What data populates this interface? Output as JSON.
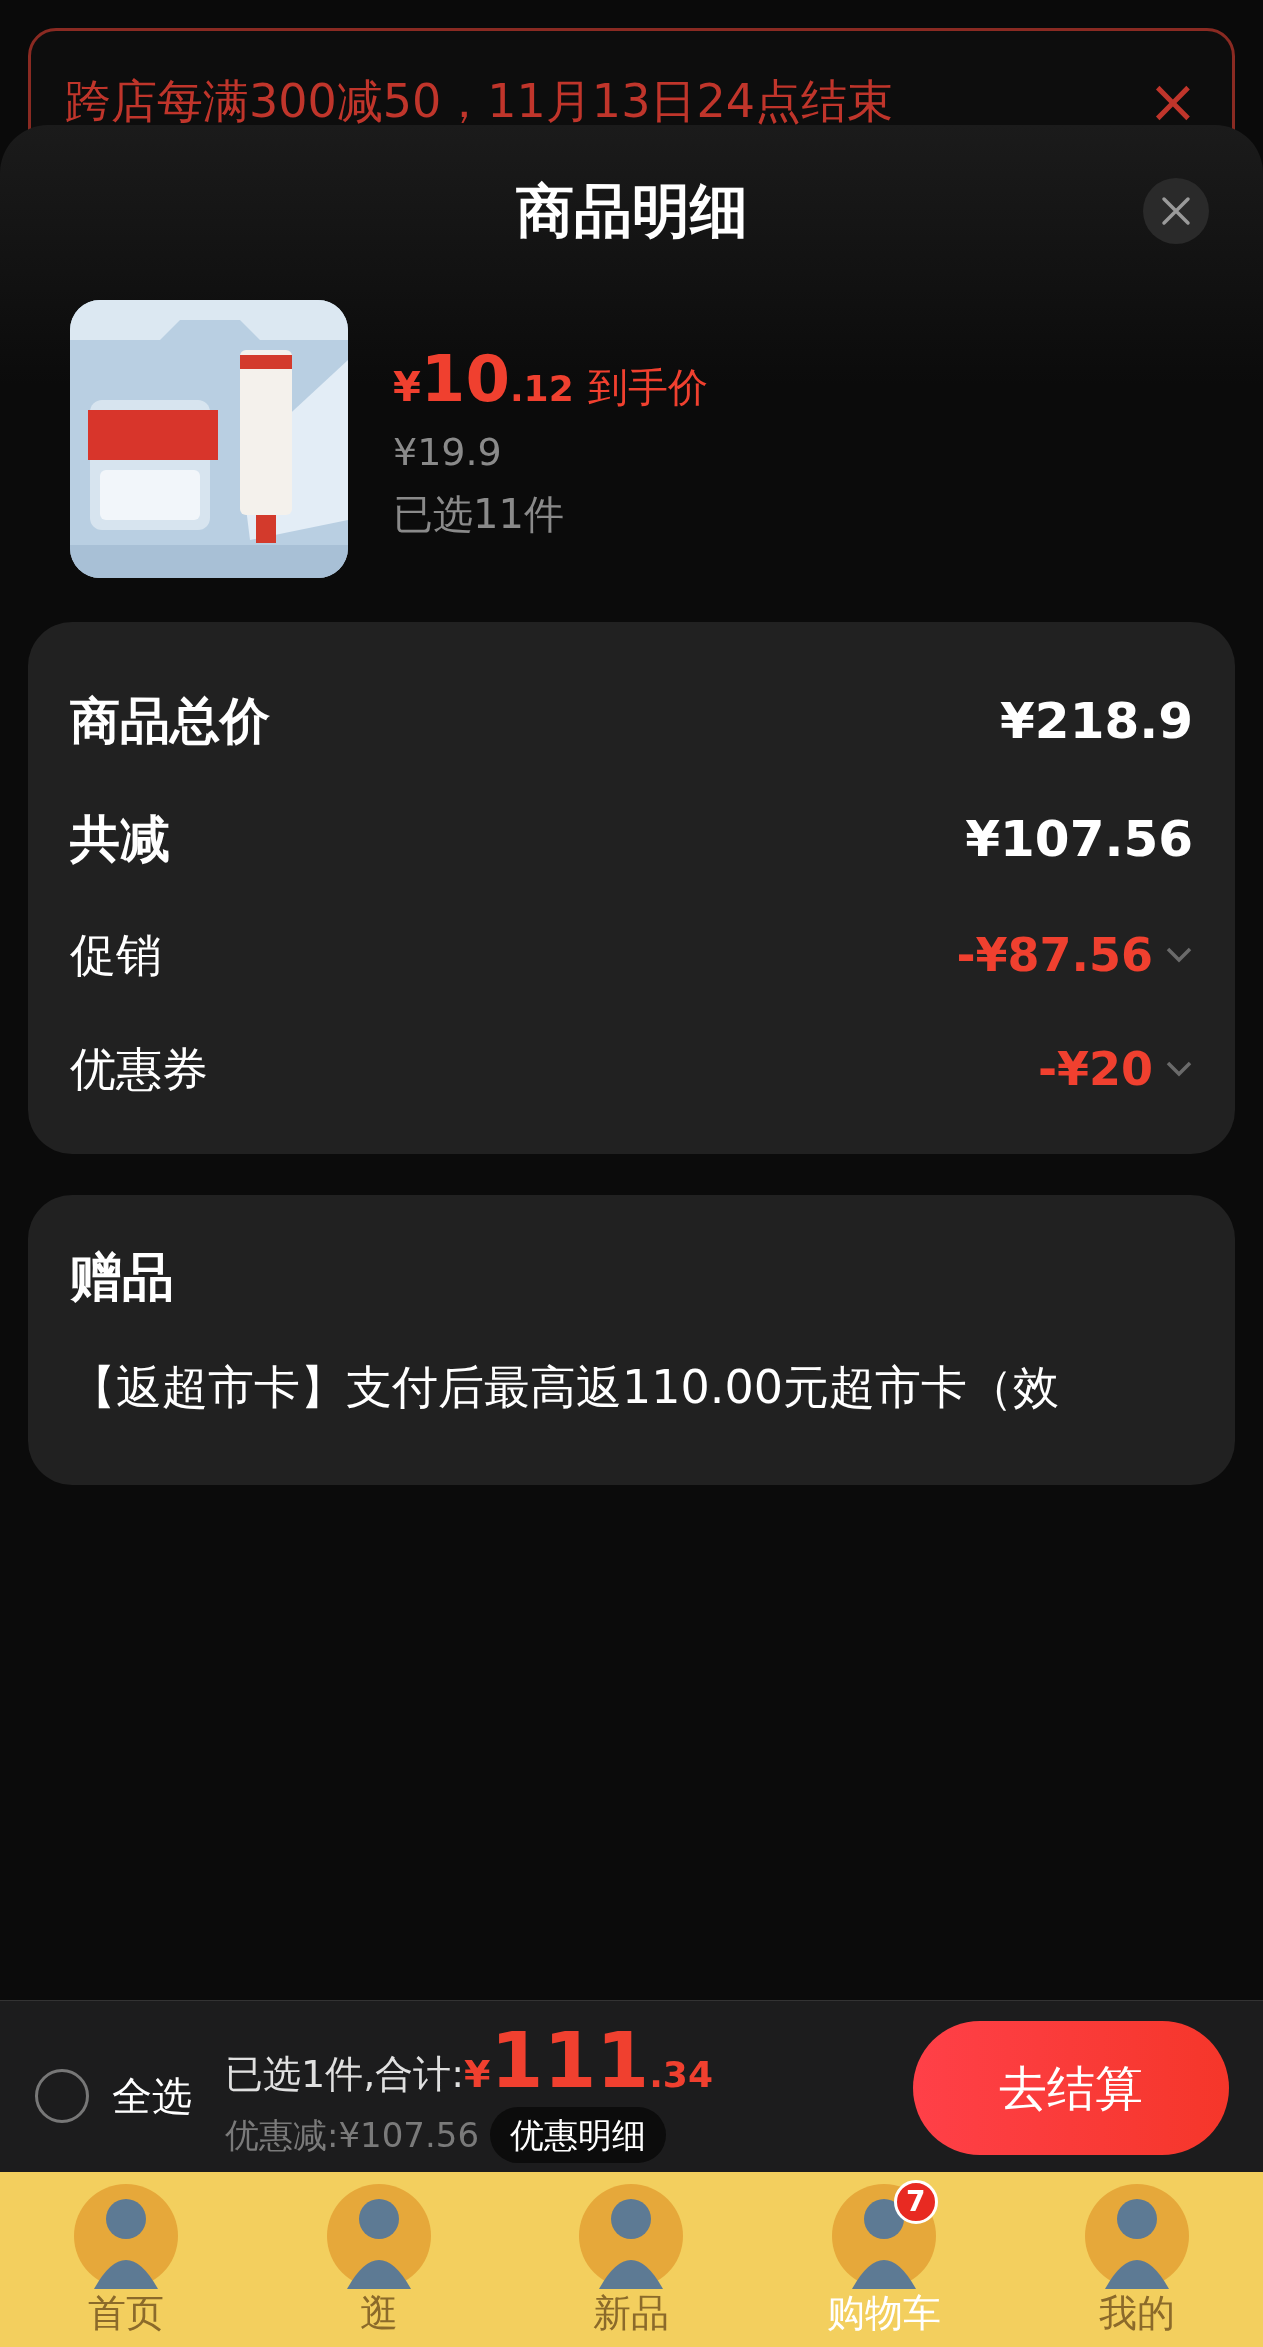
{
  "promo_banner": {
    "text": "跨店每满300减50，11月13日24点结束",
    "close": "×"
  },
  "sheet": {
    "title": "商品明细",
    "product": {
      "currency": "¥",
      "price_int": "10",
      "price_dec": ".12",
      "price_label": "到手价",
      "original_price": "¥19.9",
      "selected_count": "已选11件"
    },
    "summary": [
      {
        "kind": "main",
        "label": "商品总价",
        "value": "¥218.9"
      },
      {
        "kind": "main",
        "label": "共减",
        "value": "¥107.56"
      },
      {
        "kind": "detail",
        "label": "促销",
        "value": "-¥87.56"
      },
      {
        "kind": "detail",
        "label": "优惠券",
        "value": "-¥20"
      }
    ],
    "gifts": {
      "title": "赠品",
      "text": "【返超市卡】支付后最高返110.00元超市卡（效"
    }
  },
  "checkout_bar": {
    "select_all": {
      "label": "全选",
      "checked": false
    },
    "total_prefix": "已选1件,合计:",
    "currency": "¥",
    "total_int": "111",
    "total_dec": ".34",
    "discount": "优惠减:¥107.56",
    "discount_details": "优惠明细",
    "checkout": "去结算"
  },
  "tab_bar": [
    {
      "label": "首页",
      "selected": false
    },
    {
      "label": "逛",
      "selected": false
    },
    {
      "label": "新品",
      "selected": false
    },
    {
      "label": "购物车",
      "selected": true,
      "badge": "7"
    },
    {
      "label": "我的",
      "selected": false
    }
  ]
}
